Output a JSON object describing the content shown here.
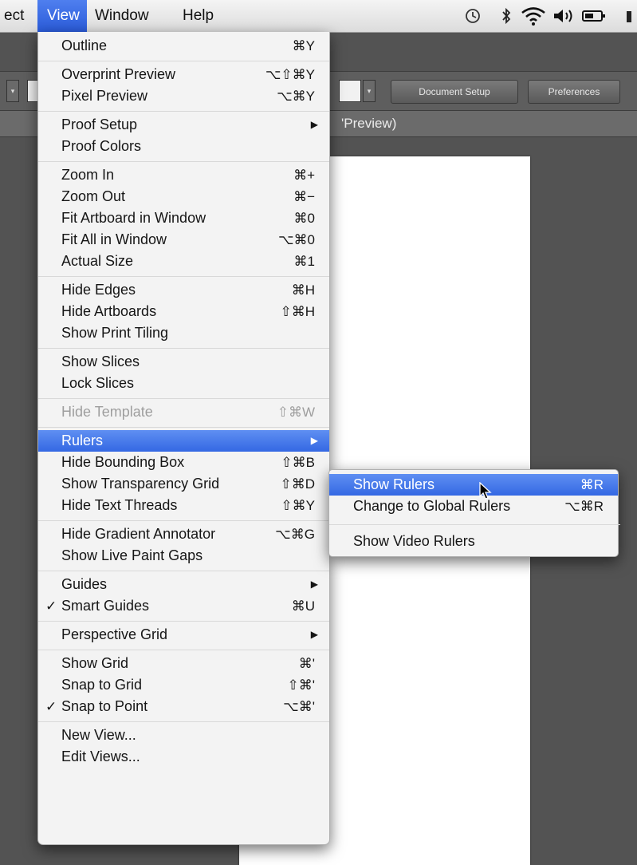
{
  "menubar": {
    "items": [
      {
        "label": "ect"
      },
      {
        "label": "View"
      },
      {
        "label": "Window"
      },
      {
        "label": "Help"
      }
    ],
    "status_icons": [
      "time-machine-icon",
      "bluetooth-icon",
      "wifi-icon",
      "volume-icon",
      "battery-icon"
    ]
  },
  "controlbar": {
    "document_setup": "Document Setup",
    "preferences": "Preferences"
  },
  "document_tab": {
    "title_fragment": "'Preview)"
  },
  "view_menu": {
    "groups": [
      [
        {
          "label": "Outline",
          "shortcut": "⌘Y"
        }
      ],
      [
        {
          "label": "Overprint Preview",
          "shortcut": "⌥⇧⌘Y"
        },
        {
          "label": "Pixel Preview",
          "shortcut": "⌥⌘Y"
        }
      ],
      [
        {
          "label": "Proof Setup",
          "submenu": true
        },
        {
          "label": "Proof Colors"
        }
      ],
      [
        {
          "label": "Zoom In",
          "shortcut": "⌘+"
        },
        {
          "label": "Zoom Out",
          "shortcut": "⌘−"
        },
        {
          "label": "Fit Artboard in Window",
          "shortcut": "⌘0"
        },
        {
          "label": "Fit All in Window",
          "shortcut": "⌥⌘0"
        },
        {
          "label": "Actual Size",
          "shortcut": "⌘1"
        }
      ],
      [
        {
          "label": "Hide Edges",
          "shortcut": "⌘H"
        },
        {
          "label": "Hide Artboards",
          "shortcut": "⇧⌘H"
        },
        {
          "label": "Show Print Tiling"
        }
      ],
      [
        {
          "label": "Show Slices"
        },
        {
          "label": "Lock Slices"
        }
      ],
      [
        {
          "label": "Hide Template",
          "shortcut": "⇧⌘W",
          "disabled": true
        }
      ],
      [
        {
          "label": "Rulers",
          "submenu": true,
          "highlighted": true
        },
        {
          "label": "Hide Bounding Box",
          "shortcut": "⇧⌘B"
        },
        {
          "label": "Show Transparency Grid",
          "shortcut": "⇧⌘D"
        },
        {
          "label": "Hide Text Threads",
          "shortcut": "⇧⌘Y"
        }
      ],
      [
        {
          "label": "Hide Gradient Annotator",
          "shortcut": "⌥⌘G"
        },
        {
          "label": "Show Live Paint Gaps"
        }
      ],
      [
        {
          "label": "Guides",
          "submenu": true
        },
        {
          "label": "Smart Guides",
          "shortcut": "⌘U",
          "checked": true
        }
      ],
      [
        {
          "label": "Perspective Grid",
          "submenu": true
        }
      ],
      [
        {
          "label": "Show Grid",
          "shortcut": "⌘'"
        },
        {
          "label": "Snap to Grid",
          "shortcut": "⇧⌘'"
        },
        {
          "label": "Snap to Point",
          "shortcut": "⌥⌘'",
          "checked": true
        }
      ],
      [
        {
          "label": "New View..."
        },
        {
          "label": "Edit Views..."
        }
      ]
    ]
  },
  "rulers_submenu": {
    "groups": [
      [
        {
          "label": "Show Rulers",
          "shortcut": "⌘R",
          "highlighted": true
        },
        {
          "label": "Change to Global Rulers",
          "shortcut": "⌥⌘R"
        }
      ],
      [
        {
          "label": "Show Video Rulers"
        }
      ]
    ]
  },
  "colors": {
    "highlight": "#3468e3",
    "menu_bg": "#f3f3f3",
    "app_bg": "#535353"
  },
  "check_glyph": "✓",
  "submenu_glyph": "▶"
}
